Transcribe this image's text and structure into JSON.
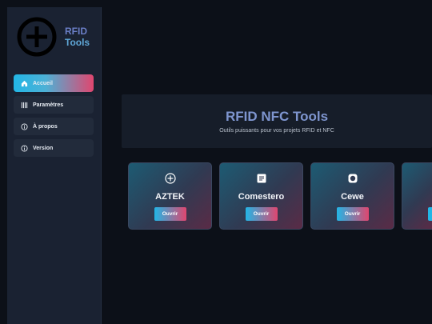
{
  "brand": {
    "line1": "RFID",
    "line2": "Tools",
    "logo_icon": "circle-plus-icon"
  },
  "sidebar": {
    "items": [
      {
        "label": "Accueil",
        "icon": "home-icon",
        "active": true
      },
      {
        "label": "Paramètres",
        "icon": "bars-icon",
        "active": false
      },
      {
        "label": "À propos",
        "icon": "info-icon",
        "active": false
      },
      {
        "label": "Version",
        "icon": "info-icon",
        "active": false
      }
    ]
  },
  "hero": {
    "title": "RFID NFC Tools",
    "subtitle": "Outils puissants pour vos projets RFID et NFC"
  },
  "cards": [
    {
      "title": "AZTEK",
      "icon": "plus-circle-icon",
      "button": "Ouvrir"
    },
    {
      "title": "Comestero",
      "icon": "document-icon",
      "button": "Ouvrir"
    },
    {
      "title": "Cewe",
      "icon": "disc-icon",
      "button": "Ouvrir"
    },
    {
      "title": "",
      "icon": "",
      "button": ""
    }
  ],
  "colors": {
    "accent_blue": "#22b6e6",
    "accent_pink": "#e0466f",
    "background": "#0c1018",
    "sidebar": "#1a2232"
  }
}
